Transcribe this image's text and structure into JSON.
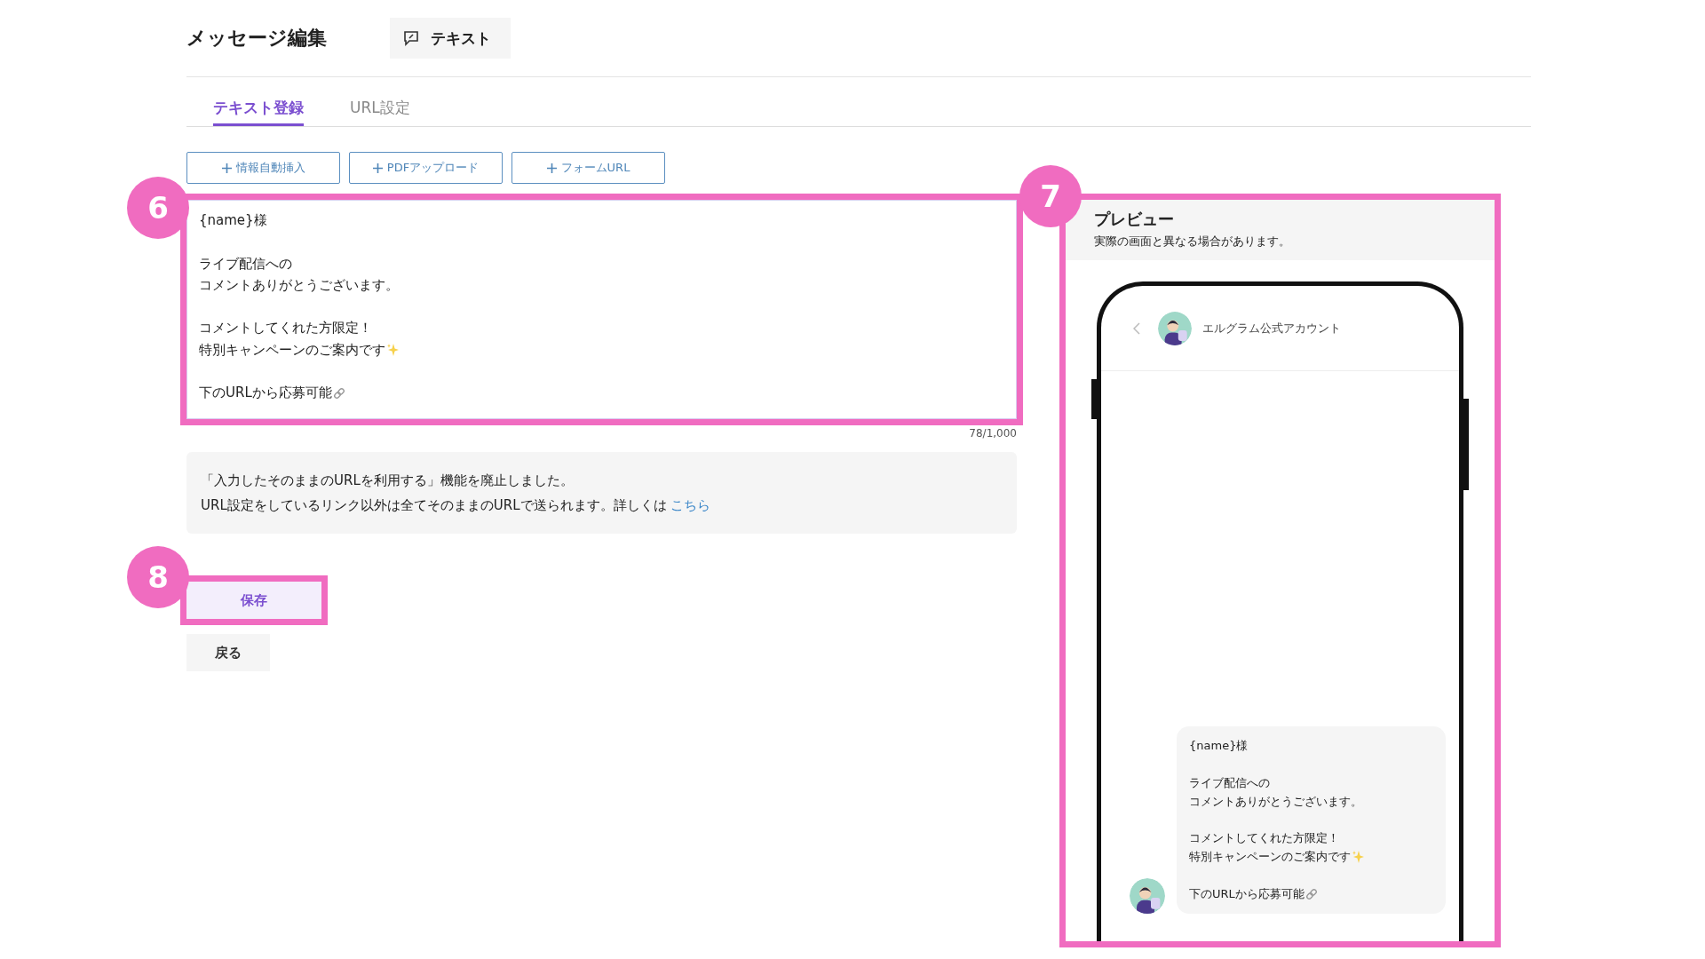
{
  "header": {
    "title": "メッセージ編集",
    "type_label": "テキスト"
  },
  "tabs": [
    {
      "label": "テキスト登録",
      "selected": true
    },
    {
      "label": "URL設定",
      "selected": false
    }
  ],
  "toolbar": [
    "情報自動挿入",
    "PDFアップロード",
    "フォームURL"
  ],
  "editor": {
    "message": [
      {
        "kind": "text",
        "text": "{name}様"
      },
      {
        "kind": "blank"
      },
      {
        "kind": "text",
        "text": "ライブ配信への"
      },
      {
        "kind": "text",
        "text": "コメントありがとうございます。"
      },
      {
        "kind": "blank"
      },
      {
        "kind": "text",
        "text": "コメントしてくれた方限定！"
      },
      {
        "kind": "sparkle",
        "text": "特別キャンペーンのご案内です"
      },
      {
        "kind": "blank"
      },
      {
        "kind": "link",
        "text": "下のURLから応募可能"
      }
    ],
    "counter": "78/1,000",
    "annotation": "6"
  },
  "notice": {
    "lines": [
      "「入力したそのままのURLを利用する」機能を廃止しました。",
      "URL設定をしているリンク以外は全てそのままのURLで送られます。詳しくは"
    ],
    "link": "こちら"
  },
  "actions": {
    "save": "保存",
    "back": "戻る",
    "annotation": "8"
  },
  "preview": {
    "annotation": "7",
    "title": "プレビュー",
    "note": "実際の画面と異なる場合があります。",
    "account": "エルグラム公式アカウント",
    "message": [
      {
        "kind": "text",
        "text": "{name}様"
      },
      {
        "kind": "blank"
      },
      {
        "kind": "text",
        "text": "ライブ配信への"
      },
      {
        "kind": "text",
        "text": "コメントありがとうございます。"
      },
      {
        "kind": "blank"
      },
      {
        "kind": "text",
        "text": "コメントしてくれた方限定！"
      },
      {
        "kind": "sparkle",
        "text": "特別キャンペーンのご案内です"
      },
      {
        "kind": "blank"
      },
      {
        "kind": "link",
        "text": "下のURLから応募可能"
      }
    ]
  }
}
